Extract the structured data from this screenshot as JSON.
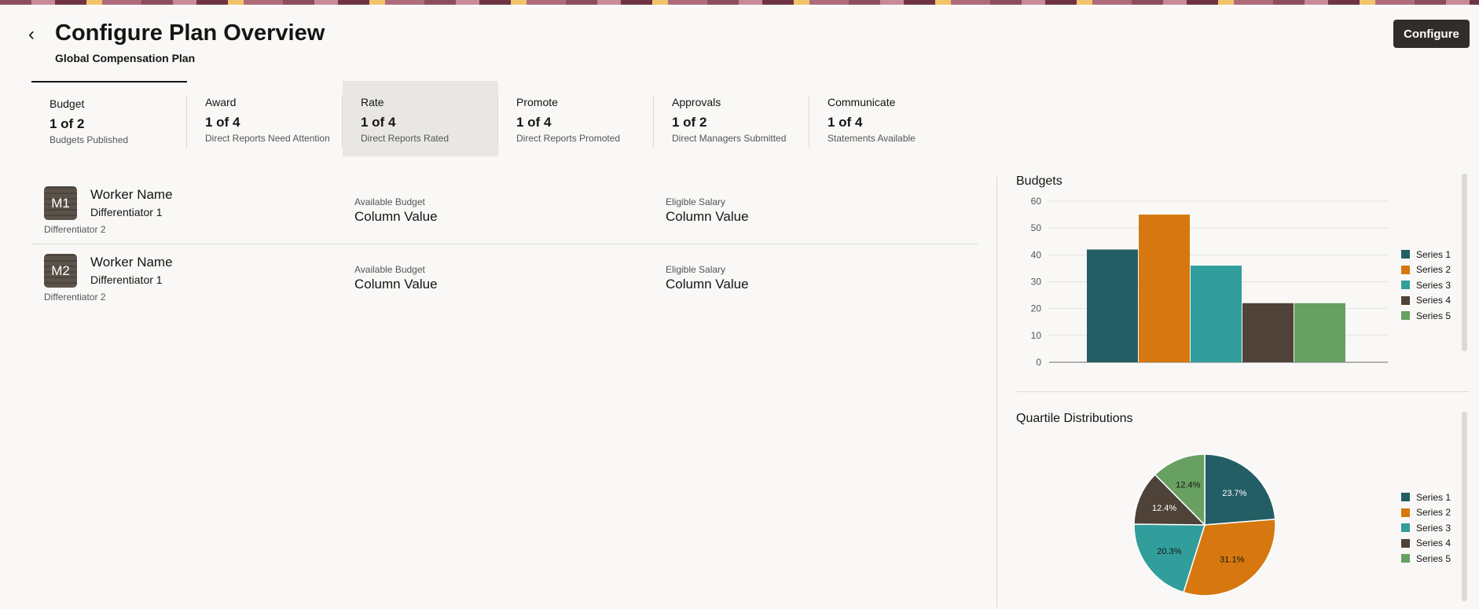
{
  "header": {
    "title": "Configure Plan Overview",
    "subtitle": "Global Compensation Plan",
    "configure_label": "Configure",
    "back_icon": "‹"
  },
  "tabs": [
    {
      "label": "Budget",
      "count": "1 of 2",
      "status": "Budgets Published"
    },
    {
      "label": "Award",
      "count": "1 of 4",
      "status": "Direct Reports Need Attention"
    },
    {
      "label": "Rate",
      "count": "1 of 4",
      "status": "Direct Reports Rated"
    },
    {
      "label": "Promote",
      "count": "1 of 4",
      "status": "Direct Reports Promoted"
    },
    {
      "label": "Approvals",
      "count": "1 of 2",
      "status": "Direct Managers Submitted"
    },
    {
      "label": "Communicate",
      "count": "1 of 4",
      "status": "Statements Available"
    }
  ],
  "workers": [
    {
      "initials": "M1",
      "name": "Worker Name",
      "diff1": "Differentiator 1",
      "diff2": "Differentiator 2",
      "budget_label": "Available Budget",
      "budget_value": "Column Value",
      "salary_label": "Eligible Salary",
      "salary_value": "Column Value"
    },
    {
      "initials": "M2",
      "name": "Worker Name",
      "diff1": "Differentiator 1",
      "diff2": "Differentiator 2",
      "budget_label": "Available Budget",
      "budget_value": "Column Value",
      "salary_label": "Eligible Salary",
      "salary_value": "Column Value"
    }
  ],
  "chart_data": [
    {
      "type": "bar",
      "title": "Budgets",
      "categories": [
        "Series 1",
        "Series 2",
        "Series 3",
        "Series 4",
        "Series 5"
      ],
      "values": [
        42,
        55,
        36,
        22,
        22
      ],
      "ylim": [
        0,
        60
      ],
      "yticks": [
        "0",
        "10",
        "20",
        "30",
        "40",
        "50",
        "60"
      ],
      "legend": "right",
      "grid": true,
      "colors": [
        "#235e65",
        "#d6780f",
        "#329e9b",
        "#4e4239",
        "#68a062"
      ]
    },
    {
      "type": "pie",
      "title": "Quartile Distributions",
      "categories": [
        "Series 1",
        "Series 2",
        "Series 3",
        "Series 4",
        "Series 5"
      ],
      "values": [
        23.7,
        31.1,
        20.3,
        12.4,
        12.4
      ],
      "labels": [
        "23.7%",
        "31.1%",
        "20.3%",
        "12.4%",
        "12.4%"
      ],
      "legend": "right",
      "colors": [
        "#235e65",
        "#d6780f",
        "#329e9b",
        "#4e4239",
        "#68a062"
      ]
    }
  ]
}
